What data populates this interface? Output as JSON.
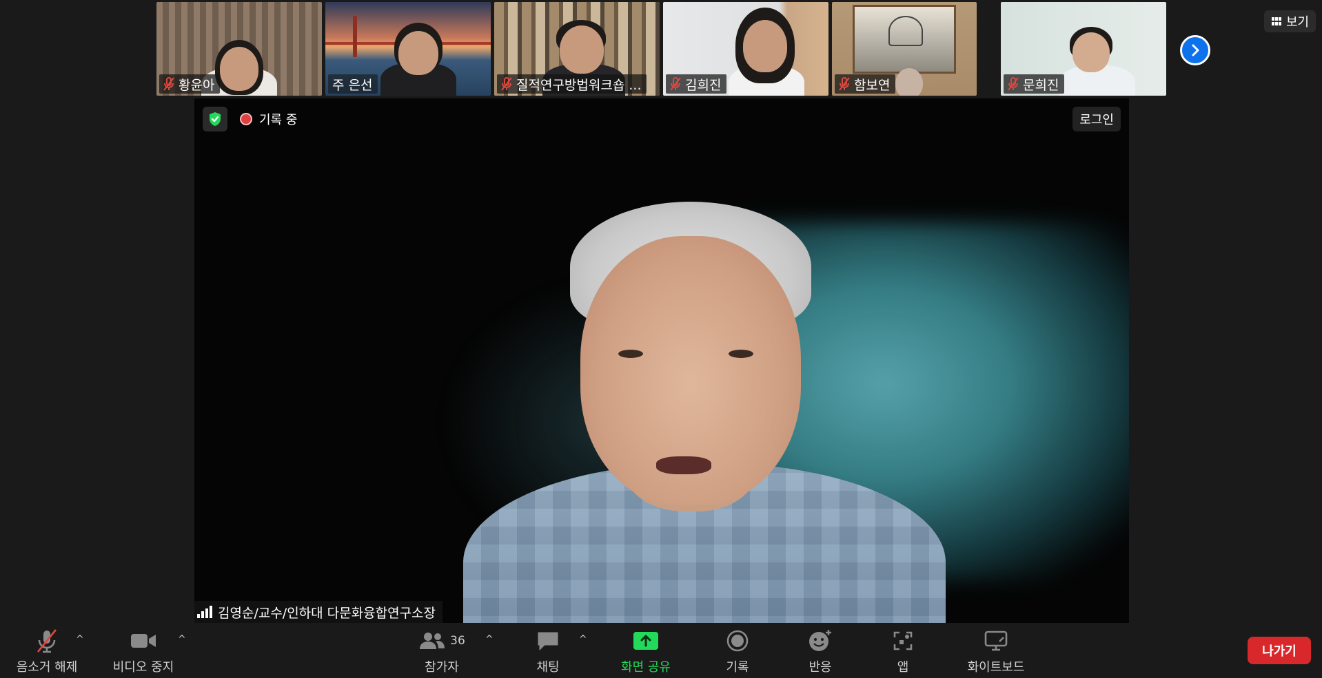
{
  "top_strip": {
    "participants": [
      {
        "name": "황윤아",
        "muted": true
      },
      {
        "name": "주 은선",
        "muted": false
      },
      {
        "name": "질적연구방법워크숍 ...",
        "muted": true
      },
      {
        "name": "김희진",
        "muted": true
      },
      {
        "name": "함보연",
        "muted": true
      },
      {
        "name": "문희진",
        "muted": true
      }
    ],
    "view_label": "보기"
  },
  "main_video": {
    "recording_label": "기록 중",
    "login_label": "로그인",
    "speaker_name": "김영순/교수/인하대 다문화융합연구소장"
  },
  "toolbar": {
    "mute_label": "음소거 해제",
    "video_label": "비디오 중지",
    "participants_label": "참가자",
    "participants_count": "36",
    "chat_label": "채팅",
    "share_label": "화면 공유",
    "record_label": "기록",
    "reactions_label": "반응",
    "apps_label": "앱",
    "whiteboard_label": "화이트보드",
    "leave_label": "나가기"
  },
  "colors": {
    "background": "#1a1a1a",
    "accent_blue": "#0e72ed",
    "share_green": "#23d959",
    "leave_red": "#d8282c",
    "muted_red": "#e0473f"
  }
}
